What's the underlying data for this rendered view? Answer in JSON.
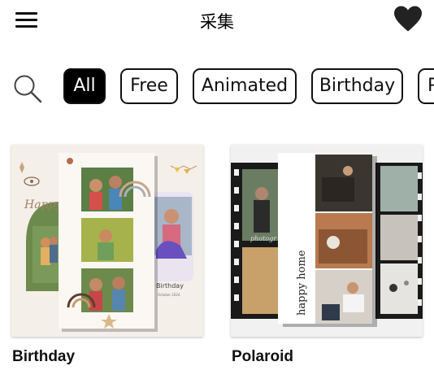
{
  "header": {
    "title": "采集",
    "menu_icon": "hamburger-menu-icon",
    "favorite_icon": "heart-icon"
  },
  "filters": {
    "search_icon": "search-icon",
    "chips": [
      {
        "label": "All",
        "active": true
      },
      {
        "label": "Free",
        "active": false
      },
      {
        "label": "Animated",
        "active": false
      },
      {
        "label": "Birthday",
        "active": false
      },
      {
        "label": "P",
        "active": false
      }
    ]
  },
  "templates": [
    {
      "name": "Birthday",
      "preview": {
        "script_text": "Happy",
        "side_title": "Birthday",
        "side_date": "October 2024"
      }
    },
    {
      "name": "Polaroid",
      "preview": {
        "caption": "happy home",
        "watermark": "photogr"
      }
    }
  ],
  "colors": {
    "accent": "#000000",
    "background": "#ffffff",
    "chip_border": "#111111"
  }
}
